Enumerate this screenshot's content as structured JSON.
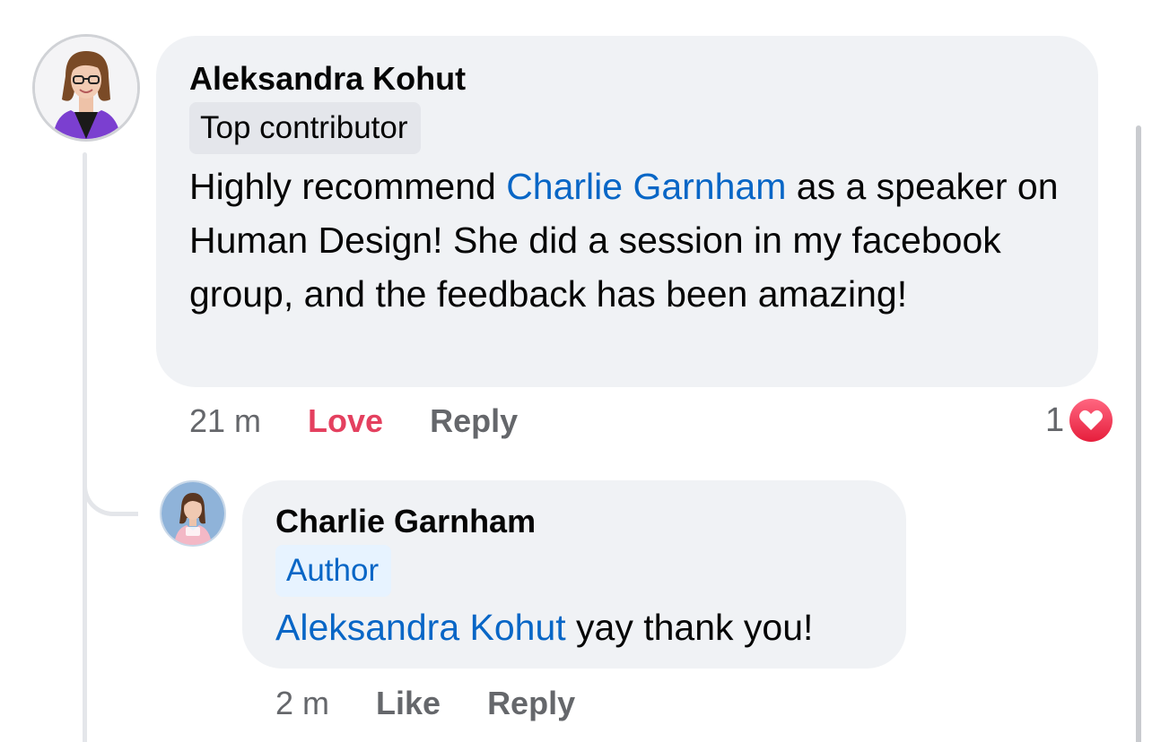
{
  "thread": {
    "comment": {
      "author": "Aleksandra Kohut",
      "badge": "Top contributor",
      "text_before": "Highly recommend ",
      "mention": "Charlie Garnham",
      "text_after": " as a speaker on Human Design! She did a session in my facebook group, and the feedback has been amazing!",
      "time": "21 m",
      "action_love": "Love",
      "action_reply": "Reply",
      "reaction_count": "1",
      "reaction_icon": "heart-icon",
      "avatar_icon": "profile-photo"
    },
    "reply": {
      "author": "Charlie Garnham",
      "badge": "Author",
      "mention": "Aleksandra Kohut",
      "text_after": " yay thank you!",
      "time": "2 m",
      "action_like": "Like",
      "action_reply": "Reply",
      "avatar_icon": "profile-photo"
    }
  },
  "colors": {
    "bubble": "#f0f2f5",
    "mention": "#0866c6",
    "love": "#e4405f",
    "muted": "#65676b"
  }
}
